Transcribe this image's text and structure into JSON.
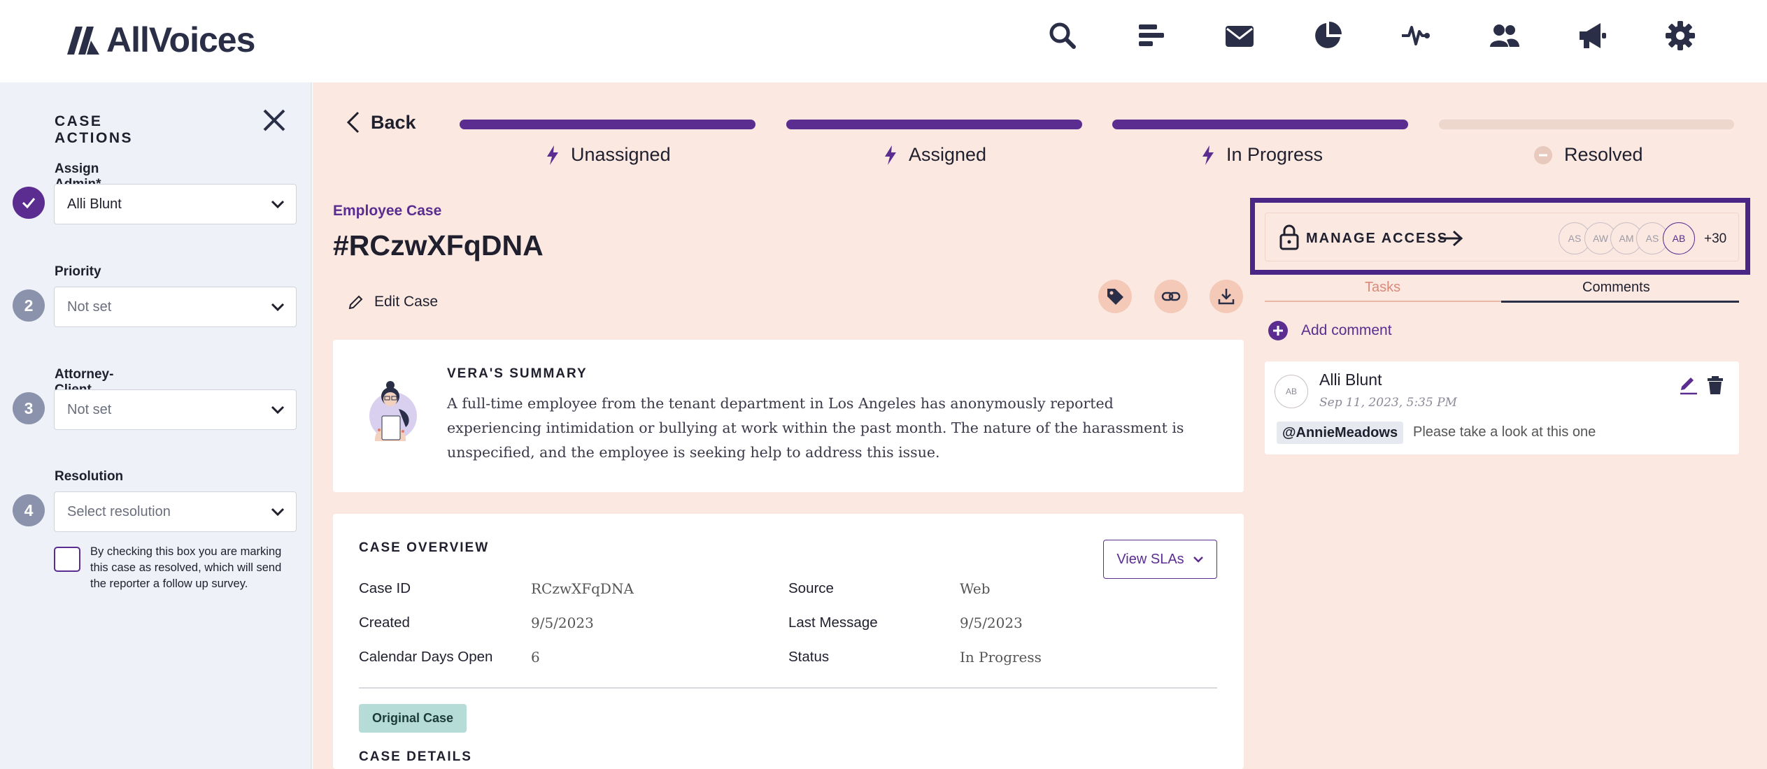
{
  "app": {
    "brand": "AllVoices"
  },
  "nav": {
    "icons": [
      "search-icon",
      "list-icon",
      "mail-icon",
      "pie-chart-icon",
      "activity-icon",
      "users-icon",
      "megaphone-icon",
      "gear-icon"
    ],
    "brand_color": "#5b2d91"
  },
  "sidebar": {
    "title": "CASE ACTIONS",
    "assign_admin": {
      "label": "Assign Admin*",
      "value": "Alli Blunt",
      "step": ""
    },
    "priority": {
      "label": "Priority",
      "value": "Not set",
      "step": "2"
    },
    "privilege": {
      "label": "Attorney-Client Privilege",
      "value": "Not set",
      "step": "3"
    },
    "resolution": {
      "label": "Resolution",
      "value": "Select resolution",
      "step": "4"
    },
    "checkbox_text": "By checking this box you are marking this case as resolved, which will send the reporter a follow up survey."
  },
  "header": {
    "back_label": "Back",
    "stages": [
      {
        "label": "Unassigned",
        "done": true
      },
      {
        "label": "Assigned",
        "done": true
      },
      {
        "label": "In Progress",
        "done": true
      },
      {
        "label": "Resolved",
        "done": false
      }
    ]
  },
  "case": {
    "type": "Employee Case",
    "id": "#RCzwXFqDNA",
    "edit_label": "Edit Case"
  },
  "summary": {
    "title": "VERA'S SUMMARY",
    "text": "A full-time employee from the tenant department in Los Angeles has anonymously reported experiencing intimidation or bullying at work within the past month. The nature of the harassment is unspecified, and the employee is seeking help to address this issue."
  },
  "overview": {
    "title": "CASE OVERVIEW",
    "view_slas": "View SLAs",
    "rows": [
      {
        "key": "Case ID",
        "value": "RCzwXFqDNA",
        "key2": "Source",
        "value2": "Web"
      },
      {
        "key": "Created",
        "value": "9/5/2023",
        "key2": "Last Message",
        "value2": "9/5/2023"
      },
      {
        "key": "Calendar Days Open",
        "value": "6",
        "key2": "Status",
        "value2": "In Progress"
      }
    ],
    "badge": "Original Case",
    "details_title": "CASE DETAILS"
  },
  "access": {
    "label": "MANAGE ACCESS",
    "avatars": [
      "AS",
      "AW",
      "AM",
      "AS",
      "AB"
    ],
    "more": "+30"
  },
  "tabs": {
    "tasks": "Tasks",
    "comments": "Comments",
    "active": "comments"
  },
  "comments": {
    "add_label": "Add comment",
    "items": [
      {
        "initials": "AB",
        "author": "Alli Blunt",
        "date": "Sep 11, 2023, 5:35 PM",
        "mention": "@AnnieMeadows",
        "text": "Please take a look at this one"
      }
    ]
  }
}
